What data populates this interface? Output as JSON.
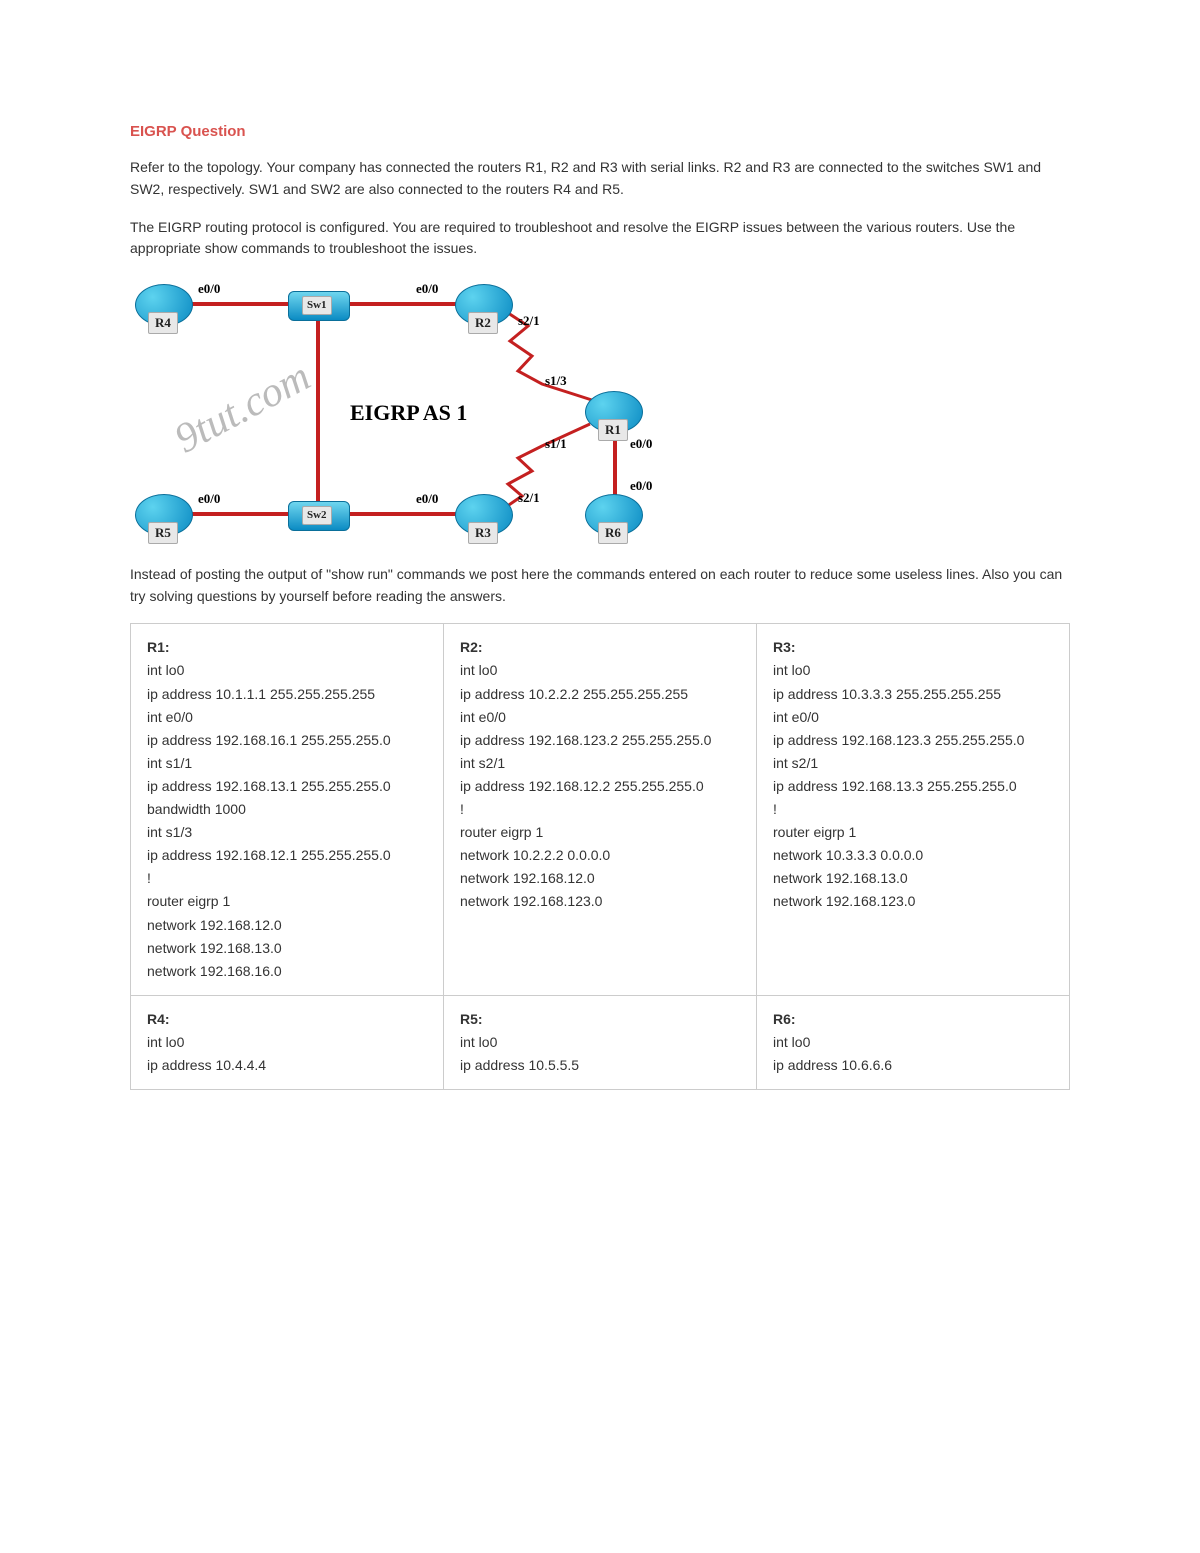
{
  "title": "EIGRP Question",
  "para1": "Refer to the topology. Your company has connected the routers R1, R2 and R3 with serial links. R2 and R3 are connected to the switches SW1 and SW2, respectively. SW1 and SW2 are also connected to the routers R4 and R5.",
  "para2": "The EIGRP routing protocol is configured. You are required to troubleshoot and resolve the EIGRP issues between the various routers. Use the appropriate show commands to troubleshoot the issues.",
  "para3": "Instead of posting the output of \"show run\" commands we post here the commands entered on each router to reduce some useless lines. Also you can try solving questions by yourself before reading the answers.",
  "topology": {
    "as_label": "EIGRP AS 1",
    "watermark": "9tut.com",
    "nodes": {
      "R1": "R1",
      "R2": "R2",
      "R3": "R3",
      "R4": "R4",
      "R5": "R5",
      "R6": "R6",
      "SW1": "Sw1",
      "SW2": "Sw2"
    },
    "ifaces": {
      "r4_e00": "e0/0",
      "r2_e00": "e0/0",
      "r2_s21": "s2/1",
      "r1_s13": "s1/3",
      "r1_s11": "s1/1",
      "r1_e00": "e0/0",
      "r6_e00": "e0/0",
      "r3_s21": "s2/1",
      "r3_e00": "e0/0",
      "r5_e00": "e0/0"
    }
  },
  "configs": {
    "R1": {
      "name": "R1:",
      "lines": [
        "int lo0",
        "ip address 10.1.1.1 255.255.255.255",
        "int e0/0",
        "ip address 192.168.16.1 255.255.255.0",
        "int s1/1",
        "ip address 192.168.13.1 255.255.255.0",
        "bandwidth 1000",
        "int s1/3",
        "ip address 192.168.12.1 255.255.255.0",
        "!",
        "router eigrp 1",
        "network 192.168.12.0",
        "network 192.168.13.0",
        "network 192.168.16.0"
      ]
    },
    "R2": {
      "name": "R2:",
      "lines": [
        "int lo0",
        "ip address 10.2.2.2 255.255.255.255",
        "int e0/0",
        "ip address 192.168.123.2 255.255.255.0",
        "int s2/1",
        "ip address 192.168.12.2 255.255.255.0",
        "!",
        "router eigrp 1",
        "network 10.2.2.2 0.0.0.0",
        "network 192.168.12.0",
        "network 192.168.123.0"
      ]
    },
    "R3": {
      "name": "R3:",
      "lines": [
        "int lo0",
        "ip address 10.3.3.3 255.255.255.255",
        "int e0/0",
        "ip address 192.168.123.3 255.255.255.0",
        "int s2/1",
        "ip address 192.168.13.3 255.255.255.0",
        "!",
        "router eigrp 1",
        "network 10.3.3.3 0.0.0.0",
        "network 192.168.13.0",
        "network 192.168.123.0"
      ]
    },
    "R4": {
      "name": "R4:",
      "lines": [
        "int lo0",
        "ip address 10.4.4.4"
      ]
    },
    "R5": {
      "name": "R5:",
      "lines": [
        "int lo0",
        "ip address 10.5.5.5"
      ]
    },
    "R6": {
      "name": "R6:",
      "lines": [
        "int lo0",
        "ip address 10.6.6.6"
      ]
    }
  }
}
